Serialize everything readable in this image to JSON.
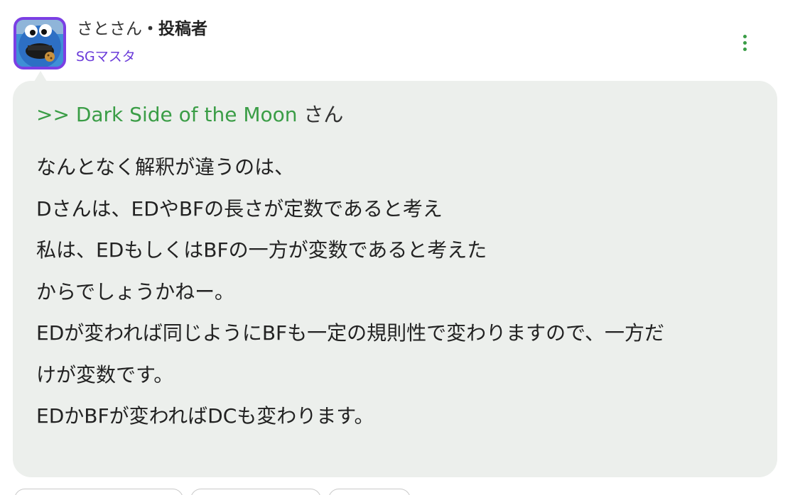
{
  "author": {
    "name": "さとさん",
    "separator": "・",
    "role": "投稿者",
    "badge": "SGマスタ"
  },
  "avatar": {
    "icon": "cookie-monster-avatar"
  },
  "menu": {
    "icon": "more-vertical-icon",
    "color": "#3a9d46"
  },
  "reply": {
    "prefix": ">> Dark Side of the Moon",
    "suffix": " さん"
  },
  "body": {
    "lines": [
      "なんとなく解釈が違うのは、",
      "Dさんは、EDやBFの長さが定数であると考え",
      "私は、EDもしくはBFの一方が変数であると考えた",
      "からでしょうかねー。",
      "EDが変われば同じようにBFも一定の規則性で変わりますので、一方だ",
      "けが変数です。",
      "EDかBFが変わればDCも変わります。"
    ]
  },
  "colors": {
    "accent": "#3a9d46",
    "badge": "#6a3ad9",
    "avatar_border": "#7b3fe4",
    "bubble_bg": "#ecefec"
  }
}
